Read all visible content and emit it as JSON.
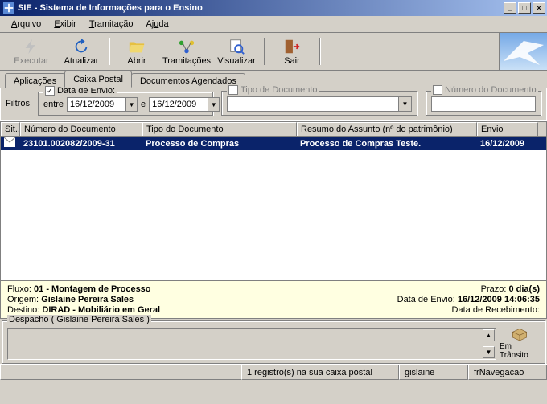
{
  "title": "SIE - Sistema de Informações para o Ensino",
  "menu": {
    "arquivo": "Arquivo",
    "exibir": "Exibir",
    "tramitacao": "Tramitação",
    "ajuda": "Ajuda"
  },
  "toolbar": {
    "executar": "Executar",
    "atualizar": "Atualizar",
    "abrir": "Abrir",
    "tramitacoes": "Tramitações",
    "visualizar": "Visualizar",
    "sair": "Sair"
  },
  "tabs": {
    "aplicacoes": "Aplicações",
    "caixa": "Caixa Postal",
    "agendados": "Documentos Agendados"
  },
  "filters": {
    "label": "Filtros",
    "data_envio_label": "Data de Envio:",
    "data_envio_checked": "✓",
    "entre": "entre",
    "e": "e",
    "date_from": "16/12/2009",
    "date_to": "16/12/2009",
    "tipo_label": "Tipo de Documento",
    "numero_label": "Número do Documento"
  },
  "grid": {
    "headers": {
      "sit": "Sit...",
      "num": "Número do Documento",
      "tipo": "Tipo do Documento",
      "resumo": "Resumo do Assunto (nº do patrimônio)",
      "envio": "Envio"
    },
    "row": {
      "num": "23101.002082/2009-31",
      "tipo": "Processo de Compras",
      "resumo": "Processo de Compras Teste.",
      "envio": "16/12/2009"
    }
  },
  "details": {
    "fluxo_label": "Fluxo:",
    "fluxo_val": "01 - Montagem de Processo",
    "origem_label": "Origem:",
    "origem_val": "Gislaine Pereira Sales",
    "destino_label": "Destino:",
    "destino_val": "DIRAD - Mobiliário em Geral",
    "prazo_label": "Prazo:",
    "prazo_val": "0 dia(s)",
    "dataenvio_label": "Data de Envio:",
    "dataenvio_val": "16/12/2009  14:06:35",
    "datareceb_label": "Data de Recebimento:",
    "datareceb_val": ""
  },
  "despacho": {
    "title": "Despacho ( Gislaine Pereira Sales )"
  },
  "status": {
    "transito": "Em Trânsito"
  },
  "statusbar": {
    "count": "1 registro(s) na sua caixa postal",
    "user": "gislaine",
    "form": "frNavegacao"
  }
}
